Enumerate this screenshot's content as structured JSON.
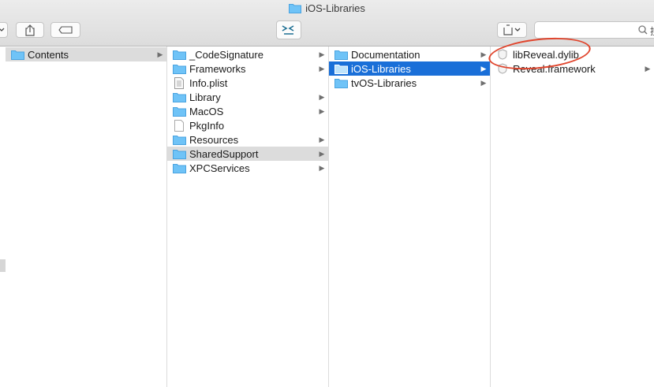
{
  "window": {
    "title": "iOS-Libraries"
  },
  "toolbar": {
    "share_icon": "share-icon",
    "tag_icon": "tag-icon",
    "terminal_icon": "terminal-icon",
    "action_icon": "action-menu-icon",
    "search_icon": "search-icon",
    "search_partial": "搜"
  },
  "columns": [
    {
      "items": [
        {
          "label": "Contents",
          "icon": "folder",
          "arrow": true,
          "selected": "grey"
        }
      ]
    },
    {
      "items": [
        {
          "label": "_CodeSignature",
          "icon": "folder",
          "arrow": true
        },
        {
          "label": "Frameworks",
          "icon": "folder",
          "arrow": true
        },
        {
          "label": "Info.plist",
          "icon": "plist",
          "arrow": false
        },
        {
          "label": "Library",
          "icon": "folder",
          "arrow": true
        },
        {
          "label": "MacOS",
          "icon": "folder",
          "arrow": true
        },
        {
          "label": "PkgInfo",
          "icon": "doc",
          "arrow": false
        },
        {
          "label": "Resources",
          "icon": "folder",
          "arrow": true
        },
        {
          "label": "SharedSupport",
          "icon": "folder",
          "arrow": true,
          "selected": "grey"
        },
        {
          "label": "XPCServices",
          "icon": "folder",
          "arrow": true
        }
      ]
    },
    {
      "items": [
        {
          "label": "Documentation",
          "icon": "folder",
          "arrow": true
        },
        {
          "label": "iOS-Libraries",
          "icon": "folder",
          "arrow": true,
          "selected": "blue"
        },
        {
          "label": "tvOS-Libraries",
          "icon": "folder",
          "arrow": true
        }
      ]
    },
    {
      "items": [
        {
          "label": "libReveal.dylib",
          "icon": "shield",
          "arrow": false
        },
        {
          "label": "Reveal.framework",
          "icon": "shield",
          "arrow": true
        }
      ]
    }
  ],
  "colors": {
    "selection_blue": "#1a6fd8",
    "folder": "#6fc3f7",
    "annotation_red": "#e0452d"
  }
}
